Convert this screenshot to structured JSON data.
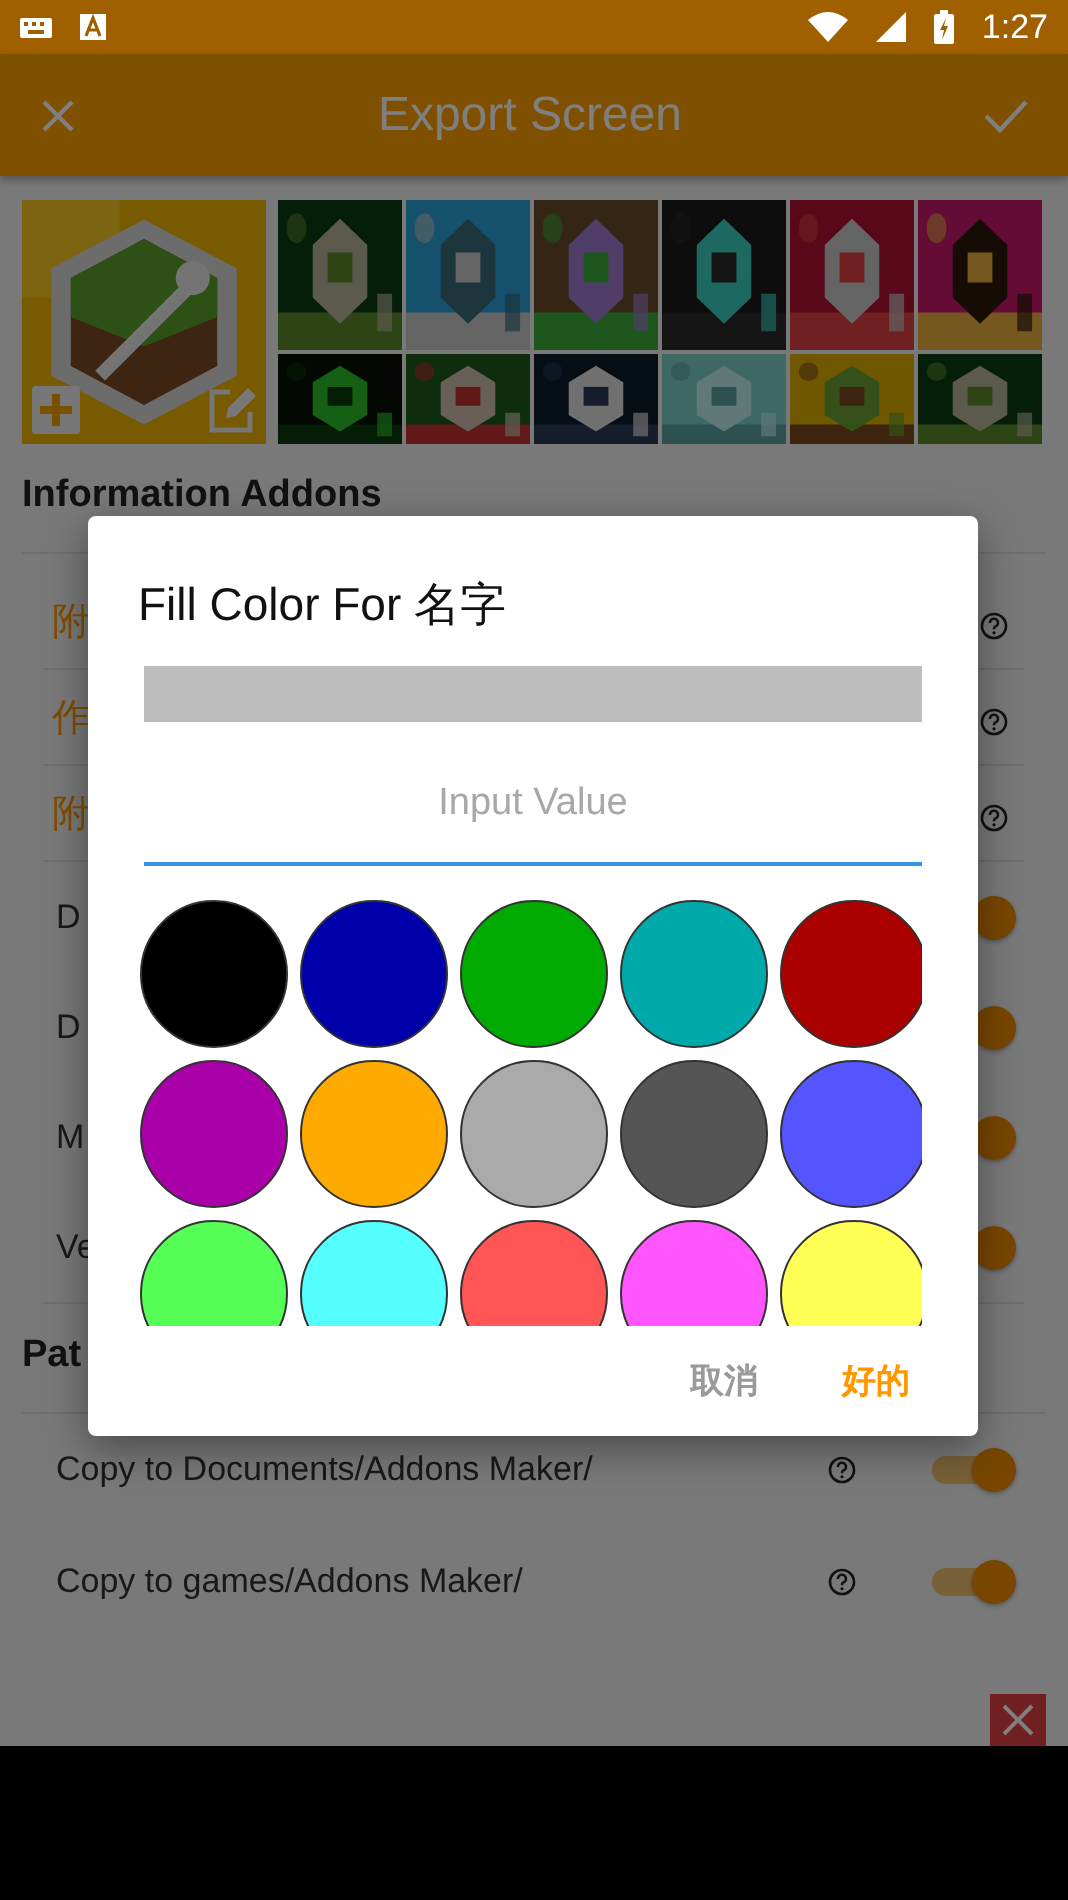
{
  "status_bar": {
    "time": "1:27"
  },
  "toolbar": {
    "title": "Export Screen"
  },
  "sections": [
    {
      "title": "Information Addons",
      "rows": [
        {
          "kind": "field",
          "label": "附",
          "help": true
        },
        {
          "kind": "field",
          "label": "作",
          "help": true
        },
        {
          "kind": "field",
          "label": "附",
          "help": true
        },
        {
          "kind": "switch",
          "label": "D",
          "help": false,
          "on": true
        },
        {
          "kind": "switch",
          "label": "D",
          "help": false,
          "on": true
        },
        {
          "kind": "switch",
          "label": "M",
          "help": false,
          "on": true
        },
        {
          "kind": "switch",
          "label": "Ve",
          "help": false,
          "on": true
        }
      ]
    },
    {
      "title": "Pat",
      "rows": [
        {
          "kind": "switch",
          "label": "Copy to Documents/Addons Maker/",
          "help": true,
          "on": true
        },
        {
          "kind": "switch",
          "label": "Copy to games/Addons Maker/",
          "help": true,
          "on": true
        }
      ]
    }
  ],
  "dialog": {
    "title": "Fill Color For 名字",
    "input": {
      "placeholder": "Input Value"
    },
    "swatches": [
      {
        "color": "#000000"
      },
      {
        "color": "#0000aa"
      },
      {
        "color": "#00aa00"
      },
      {
        "color": "#00aaaa"
      },
      {
        "color": "#aa0000"
      },
      {
        "color": "#aa00aa"
      },
      {
        "color": "#ffaa00"
      },
      {
        "color": "#aaaaaa"
      },
      {
        "color": "#555555"
      },
      {
        "color": "#5555ff"
      },
      {
        "color": "#55ff55"
      },
      {
        "color": "#55ffff"
      },
      {
        "color": "#ff5555"
      },
      {
        "color": "#ff55ff"
      },
      {
        "color": "#ffff55"
      }
    ],
    "buttons": [
      {
        "kind": "cancel",
        "label": "取消"
      },
      {
        "kind": "confirm",
        "label": "好的"
      }
    ]
  }
}
